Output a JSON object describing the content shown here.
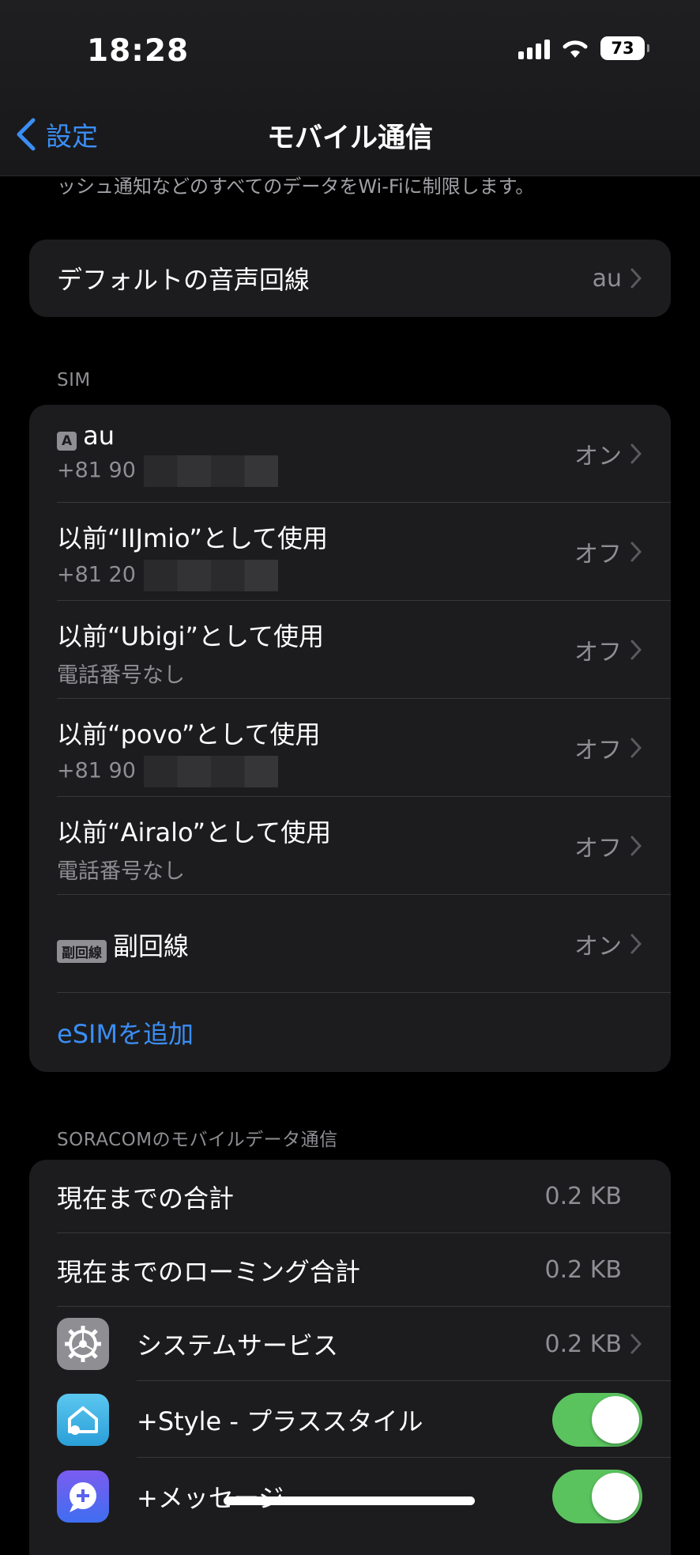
{
  "status_bar": {
    "time": "18:28",
    "battery": "73"
  },
  "nav": {
    "back_label": "設定",
    "title": "モバイル通信"
  },
  "truncated_text": "ッシュ通知などのすべてのデータをWi-Fiに制限します。",
  "default_voice": {
    "label": "デフォルトの音声回線",
    "value": "au"
  },
  "sim_section": {
    "header": "SIM",
    "items": [
      {
        "badge": "A",
        "label": "au",
        "number": "+81 90",
        "value": "オン"
      },
      {
        "label": "以前“IIJmio”として使用",
        "number": "+81 20",
        "value": "オフ"
      },
      {
        "label": "以前“Ubigi”として使用",
        "number": "電話番号なし",
        "value": "オフ"
      },
      {
        "label": "以前“povo”として使用",
        "number": "+81 90",
        "value": "オフ"
      },
      {
        "label": "以前“Airalo”として使用",
        "number": "電話番号なし",
        "value": "オフ"
      },
      {
        "badge": "副回線",
        "label": "副回線",
        "value": "オン"
      }
    ],
    "add_esim": "eSIMを追加"
  },
  "data_section": {
    "header": "SORACOMのモバイルデータ通信",
    "current_total": {
      "label": "現在までの合計",
      "value": "0.2 KB"
    },
    "roaming_total": {
      "label": "現在までのローミング合計",
      "value": "0.2 KB"
    },
    "apps": [
      {
        "label": "システムサービス",
        "value": "0.2 KB",
        "icon": "gear-icon"
      },
      {
        "label": "+Style - プラススタイル",
        "icon": "plus-style-icon",
        "enabled": true
      },
      {
        "label": "+メッセージ",
        "icon": "plus-message-icon",
        "enabled": true
      }
    ]
  },
  "colors": {
    "accent": "#3b8ef5",
    "toggle_on": "#5ac35e",
    "cell": "#1c1c1e"
  }
}
